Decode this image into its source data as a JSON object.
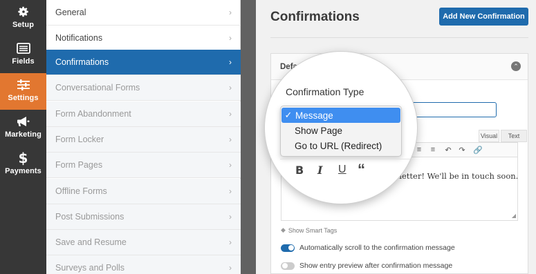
{
  "rail": {
    "items": [
      {
        "label": "Setup",
        "icon": "gear-icon"
      },
      {
        "label": "Fields",
        "icon": "fields-icon"
      },
      {
        "label": "Settings",
        "icon": "sliders-icon"
      },
      {
        "label": "Marketing",
        "icon": "megaphone-icon"
      },
      {
        "label": "Payments",
        "icon": "dollar-icon"
      }
    ],
    "active_index": 2
  },
  "menu": {
    "items": [
      {
        "label": "General"
      },
      {
        "label": "Notifications"
      },
      {
        "label": "Confirmations"
      },
      {
        "label": "Conversational Forms"
      },
      {
        "label": "Form Abandonment"
      },
      {
        "label": "Form Locker"
      },
      {
        "label": "Form Pages"
      },
      {
        "label": "Offline Forms"
      },
      {
        "label": "Post Submissions"
      },
      {
        "label": "Save and Resume"
      },
      {
        "label": "Surveys and Polls"
      }
    ],
    "active_index": 2,
    "chevron": "›"
  },
  "content": {
    "title": "Confirmations",
    "add_button": "Add New Confirmation",
    "panel_title": "Default Confirmation",
    "editor_tabs": {
      "visual": "Visual",
      "text": "Text"
    },
    "editor_text": "Thanks for joining the newsletter! We'll be in touch soon.",
    "smart_tags": "Show Smart Tags",
    "toggles": [
      {
        "label": "Automatically scroll to the confirmation message",
        "on": true
      },
      {
        "label": "Show entry preview after confirmation message",
        "on": false
      }
    ]
  },
  "magnifier": {
    "label": "Confirmation Type",
    "options": [
      "Message",
      "Show Page",
      "Go to URL (Redirect)"
    ],
    "selected": "Message",
    "check": "✓"
  },
  "colors": {
    "accent": "#1f6bad",
    "settings_active": "#e27730",
    "rail_bg": "#373737",
    "select_highlight": "#3f8ef0"
  }
}
